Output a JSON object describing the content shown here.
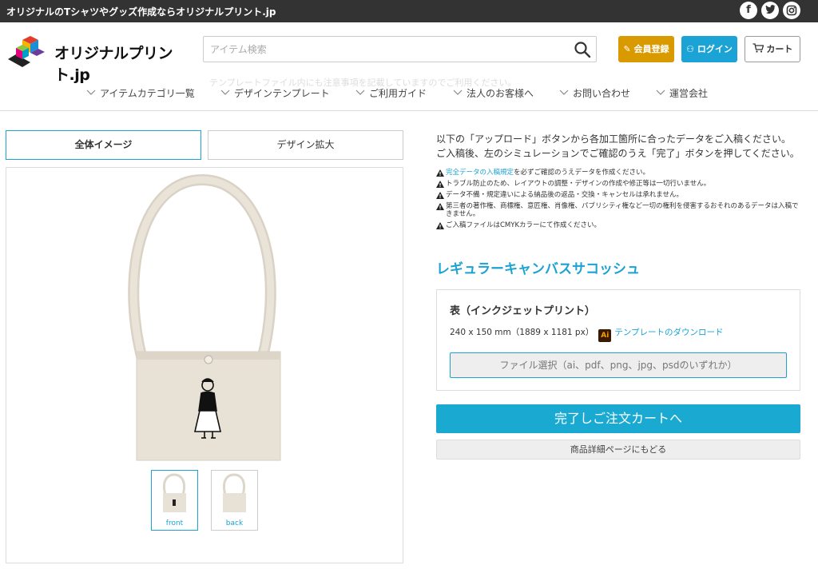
{
  "topbar": {
    "text": "オリジナルのTシャツやグッズ作成ならオリジナルプリント.jp",
    "social": [
      "facebook-icon",
      "twitter-icon",
      "instagram-icon"
    ]
  },
  "header": {
    "logo_text": "オリジナルプリント.jp",
    "search_placeholder": "アイテム検索",
    "ghost_text": "テンプレートファイル内にも注意事項を記載していますのでご利用ください。",
    "member_label": "会員登録",
    "login_label": "ログイン",
    "cart_label": "カート"
  },
  "nav": [
    "アイテムカテゴリ一覧",
    "デザインテンプレート",
    "ご利用ガイド",
    "法人のお客様へ",
    "お問い合わせ",
    "運営会社"
  ],
  "tabs": {
    "full": "全体イメージ",
    "zoom": "デザイン拡大"
  },
  "thumbs": {
    "front": "front",
    "back": "back"
  },
  "intro": {
    "line1": "以下の「アップロード」ボタンから各加工箇所に合ったデータをご入稿ください。",
    "line2": "ご入稿後、左のシミュレーションでご確認のうえ「完了」ボタンを押してください。"
  },
  "notes": {
    "n1_link": "完全データの入稿規定",
    "n1_text": "を必ずご確認のうえデータを作成ください。",
    "n2": "トラブル防止のため、レイアウトの調整・デザインの作成や修正等は一切行いません。",
    "n3": "データ不備・規定違いによる納品後の返品・交換・キャンセルは承れません。",
    "n4": "第三者の著作権、商標権、意匠権、肖像権、パブリシティ権など一切の権利を侵害するおそれのあるデータは入稿できません。",
    "n5": "ご入稿ファイルはCMYKカラーにて作成ください。"
  },
  "product": {
    "title": "レギュラーキャンバスサコッシュ",
    "side_title": "表（インクジェットプリント）",
    "size_text": "240 x 150 mm（1889 x 1181 px）",
    "ai_icon_text": "Ai",
    "template_link": "テンプレートのダウンロード",
    "file_button": "ファイル選択（ai、pdf、png、jpg、psdのいずれか）"
  },
  "actions": {
    "complete": "完了しご注文カートへ",
    "back": "商品詳細ページにもどる"
  },
  "colors": {
    "accent": "#1aa3d4",
    "member": "#d99a00",
    "topbar": "#333333"
  }
}
